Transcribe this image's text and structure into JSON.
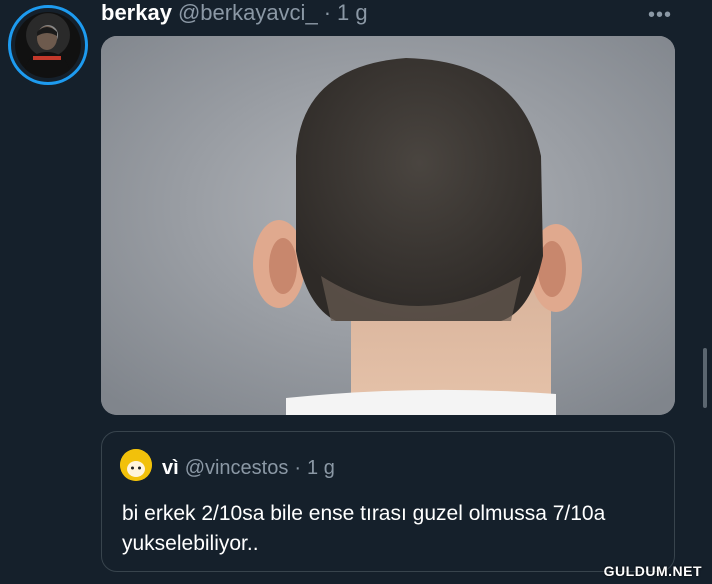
{
  "tweet": {
    "display_name": "berkay",
    "handle": "@berkayavci_",
    "separator": "·",
    "time": "1 g",
    "more_label": "•••"
  },
  "quoted_tweet": {
    "display_name": "vì",
    "handle": "@vincestos",
    "separator": "·",
    "time": "1 g",
    "text": "bi erkek 2/10sa bile ense tırası guzel olmussa 7/10a yukselebiliyor.."
  },
  "watermark": "GULDUM.NET",
  "colors": {
    "background": "#15202b",
    "accent": "#1d9bf0",
    "secondary_text": "#8b98a5",
    "border": "#38444d"
  },
  "icons": {
    "more": "more-horizontal-icon"
  }
}
